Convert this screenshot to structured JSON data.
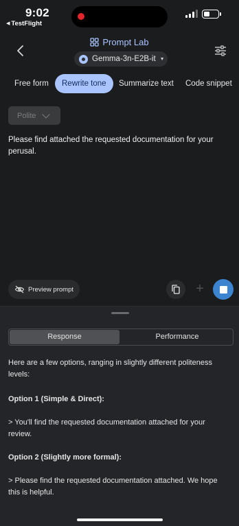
{
  "status_bar": {
    "time": "9:02",
    "back_app": "TestFlight",
    "battery_level": 0.4
  },
  "header": {
    "title": "Prompt Lab",
    "model": "Gemma-3n-E2B-it",
    "accent_color": "#a9c4ff"
  },
  "tabs": [
    {
      "label": "Free form",
      "active": false
    },
    {
      "label": "Rewrite tone",
      "active": true
    },
    {
      "label": "Summarize text",
      "active": false
    },
    {
      "label": "Code snippet",
      "active": false
    }
  ],
  "input": {
    "tone": "Polite",
    "text": "Please find attached the requested documentation for your perusal."
  },
  "actions": {
    "preview_label": "Preview prompt",
    "stop_color": "#3c84d0"
  },
  "sheet": {
    "tabs": [
      "Response",
      "Performance"
    ],
    "active_tab": "Response",
    "response": {
      "intro": "Here are a few options, ranging in slightly different politeness levels:",
      "opt1_title": "Option 1 (Simple & Direct):",
      "opt1_text": "> You'll find the requested documentation attached for your review.",
      "opt2_title": "Option 2 (Slightly more formal):",
      "opt2_text": "> Please find the requested documentation attached.  We hope this is helpful."
    }
  }
}
